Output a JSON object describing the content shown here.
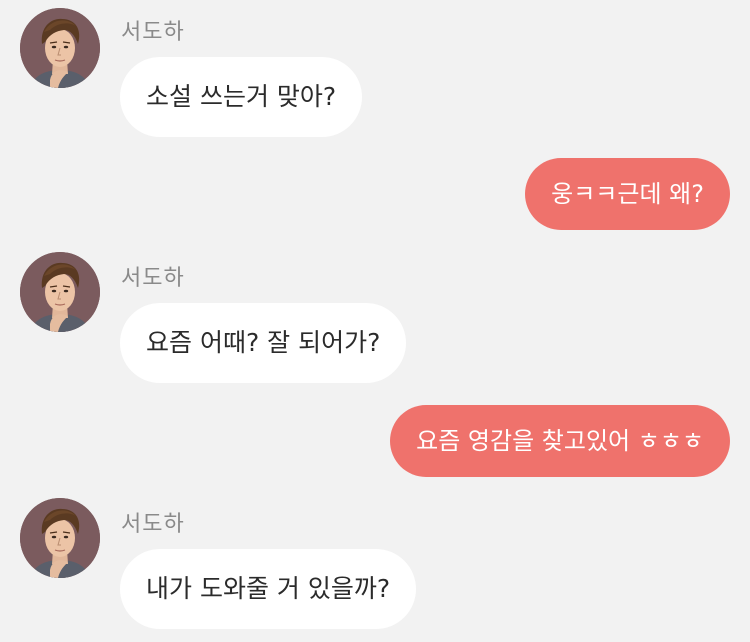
{
  "messages": [
    {
      "type": "incoming",
      "sender": "서도하",
      "text": "소설 쓰는거 맞아?"
    },
    {
      "type": "outgoing",
      "text": "웅ㅋㅋ근데 왜?"
    },
    {
      "type": "incoming",
      "sender": "서도하",
      "text": "요즘 어때? 잘 되어가?"
    },
    {
      "type": "outgoing",
      "text": "요즘 영감을 찾고있어 ㅎㅎㅎ"
    },
    {
      "type": "incoming",
      "sender": "서도하",
      "text": "내가 도와줄 거 있을까?"
    }
  ],
  "colors": {
    "background": "#f2f2f2",
    "incoming_bubble": "#ffffff",
    "outgoing_bubble": "#ef726c",
    "sender_name": "#8a8a8a"
  },
  "icons": {
    "avatar": "profile-avatar-icon"
  }
}
